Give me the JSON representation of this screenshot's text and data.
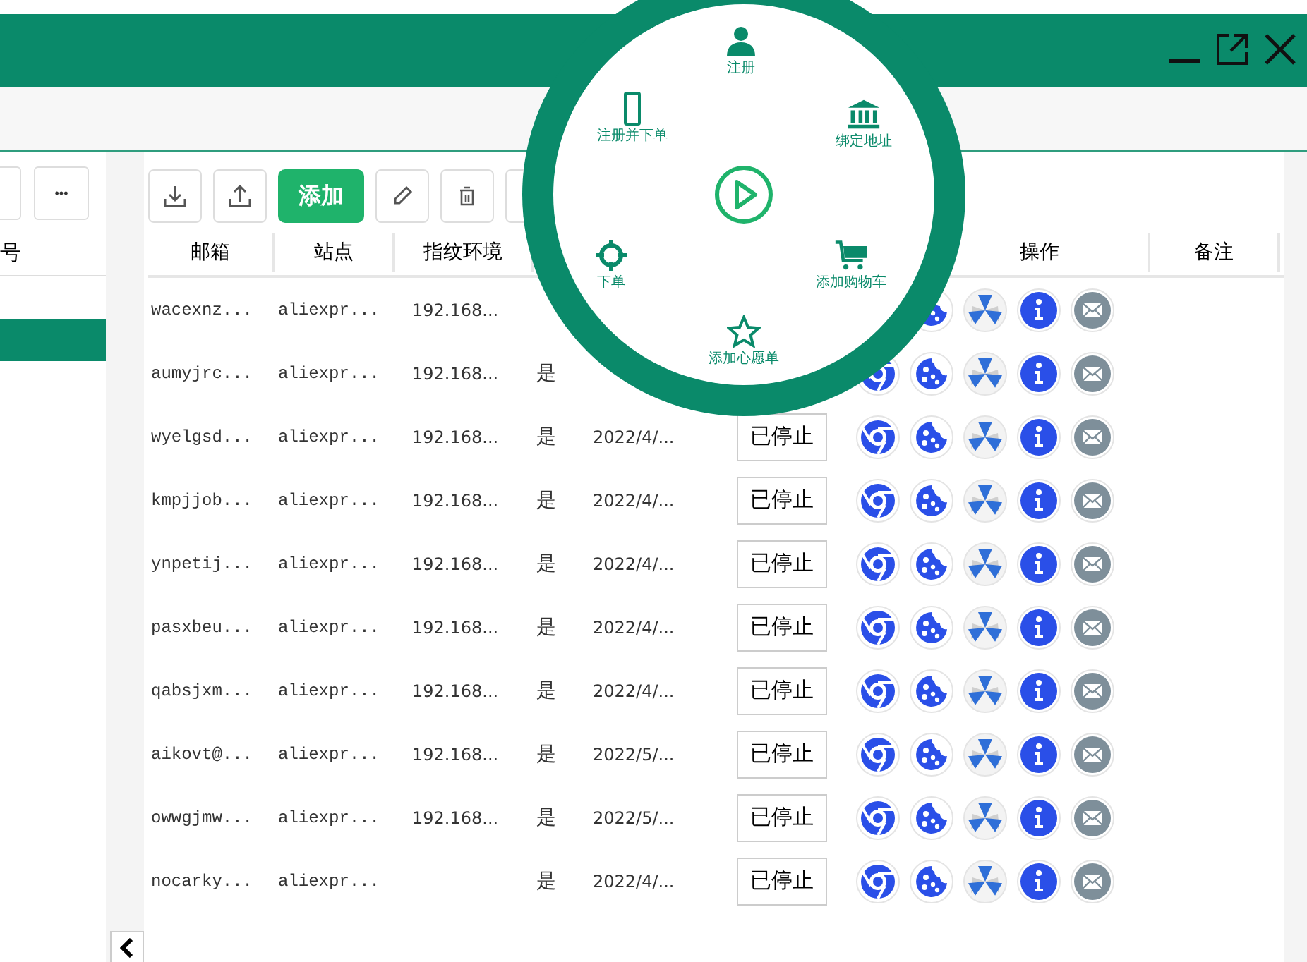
{
  "sidebar": {
    "heading": "号",
    "more_button": "•••",
    "items": [
      {
        "selected": true
      }
    ]
  },
  "toolbar": {
    "add_button": "添加"
  },
  "table": {
    "columns": [
      "邮箱",
      "站点",
      "指纹环境",
      "操作",
      "备注"
    ],
    "rows": [
      {
        "email": "wacexnz...",
        "site": "aliexpr...",
        "fingerprint": "192.168...",
        "browser_icon_shown": false
      },
      {
        "email": "aumyjrc...",
        "site": "aliexpr...",
        "fingerprint": "192.168...",
        "registered": "是",
        "browser_icon_shown": true
      },
      {
        "email": "wyelgsd...",
        "site": "aliexpr...",
        "fingerprint": "192.168...",
        "registered": "是",
        "date": "2022/4/...",
        "status": "已停止",
        "browser_icon_shown": true
      },
      {
        "email": "kmpjjob...",
        "site": "aliexpr...",
        "fingerprint": "192.168...",
        "registered": "是",
        "date": "2022/4/...",
        "status": "已停止",
        "browser_icon_shown": true
      },
      {
        "email": "ynpetij...",
        "site": "aliexpr...",
        "fingerprint": "192.168...",
        "registered": "是",
        "date": "2022/4/...",
        "status": "已停止",
        "browser_icon_shown": true
      },
      {
        "email": "pasxbeu...",
        "site": "aliexpr...",
        "fingerprint": "192.168...",
        "registered": "是",
        "date": "2022/4/...",
        "status": "已停止",
        "browser_icon_shown": true
      },
      {
        "email": "qabsjxm...",
        "site": "aliexpr...",
        "fingerprint": "192.168...",
        "registered": "是",
        "date": "2022/4/...",
        "status": "已停止",
        "browser_icon_shown": true
      },
      {
        "email": "aikovt@...",
        "site": "aliexpr...",
        "fingerprint": "192.168...",
        "registered": "是",
        "date": "2022/5/...",
        "status": "已停止",
        "browser_icon_shown": true
      },
      {
        "email": "owwgjmw...",
        "site": "aliexpr...",
        "fingerprint": "192.168...",
        "registered": "是",
        "date": "2022/5/...",
        "status": "已停止",
        "browser_icon_shown": true
      },
      {
        "email": "nocarky...",
        "site": "aliexpr...",
        "registered": "是",
        "date": "2022/4/...",
        "status": "已停止",
        "browser_icon_shown": true
      }
    ]
  },
  "radial_menu": {
    "items": [
      {
        "label": "注册",
        "kind": "user"
      },
      {
        "label": "绑定地址",
        "kind": "bank"
      },
      {
        "label": "添加购物车",
        "kind": "cart"
      },
      {
        "label": "添加心愿单",
        "kind": "star"
      },
      {
        "label": "下单",
        "kind": "target"
      },
      {
        "label": "注册并下单",
        "kind": "phone"
      }
    ]
  }
}
